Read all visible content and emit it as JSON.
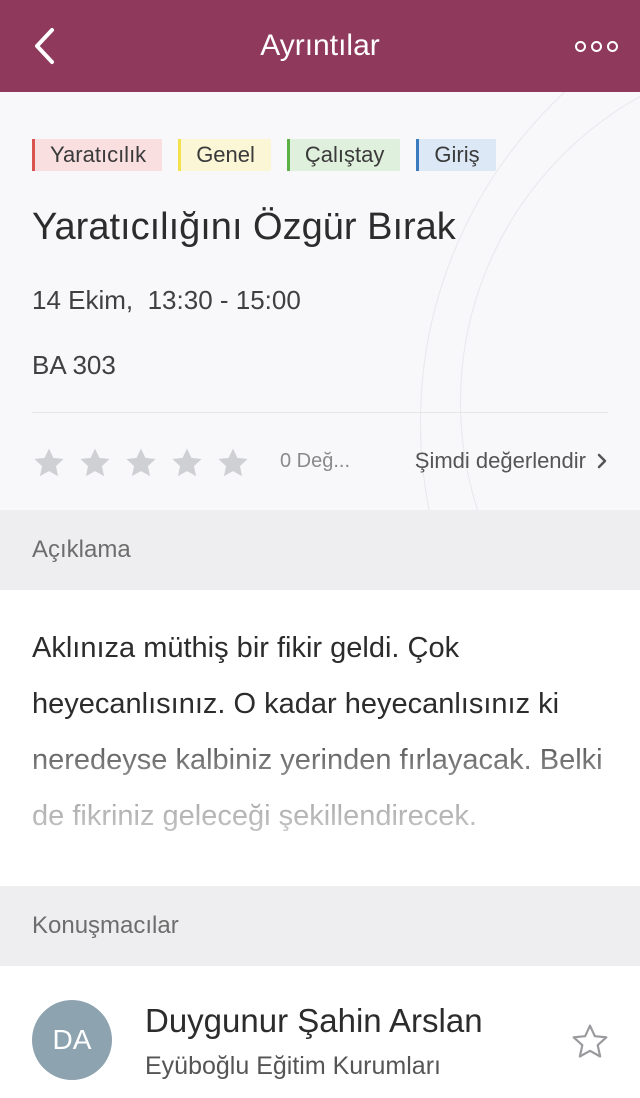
{
  "header": {
    "title": "Ayrıntılar"
  },
  "tags": [
    {
      "label": "Yaratıcılık",
      "color": "#d9534f",
      "bg": "#f9dfe0"
    },
    {
      "label": "Genel",
      "color": "#f2e14c",
      "bg": "#fbf7d6"
    },
    {
      "label": "Çalıştay",
      "color": "#5bb146",
      "bg": "#dff0dc"
    },
    {
      "label": "Giriş",
      "color": "#3a7bbf",
      "bg": "#dce8f5"
    }
  ],
  "event": {
    "title": "Yaratıcılığını Özgür Bırak",
    "date": "14 Ekim,  13:30 - 15:00",
    "room": "BA 303"
  },
  "rating": {
    "stars": 0,
    "max": 5,
    "count_label": "0 Değ...",
    "action_label": "Şimdi değerlendir"
  },
  "description": {
    "header": "Açıklama",
    "text": "Aklınıza müthiş bir fikir geldi. Çok heyecanlısınız. O kadar heyecanlısınız ki neredeyse kalbiniz yerinden fırlayacak. Belki de fikriniz geleceği şekillendirecek."
  },
  "speakers": {
    "header": "Konuşmacılar",
    "items": [
      {
        "initials": "DA",
        "name": "Duygunur Şahin Arslan",
        "organization": "Eyüboğlu Eğitim Kurumları"
      }
    ]
  },
  "colors": {
    "accent": "#8f3a5c",
    "section_bg": "#eeeef0",
    "star_empty": "#cfd0d4",
    "avatar_bg": "#8ea3b0"
  }
}
